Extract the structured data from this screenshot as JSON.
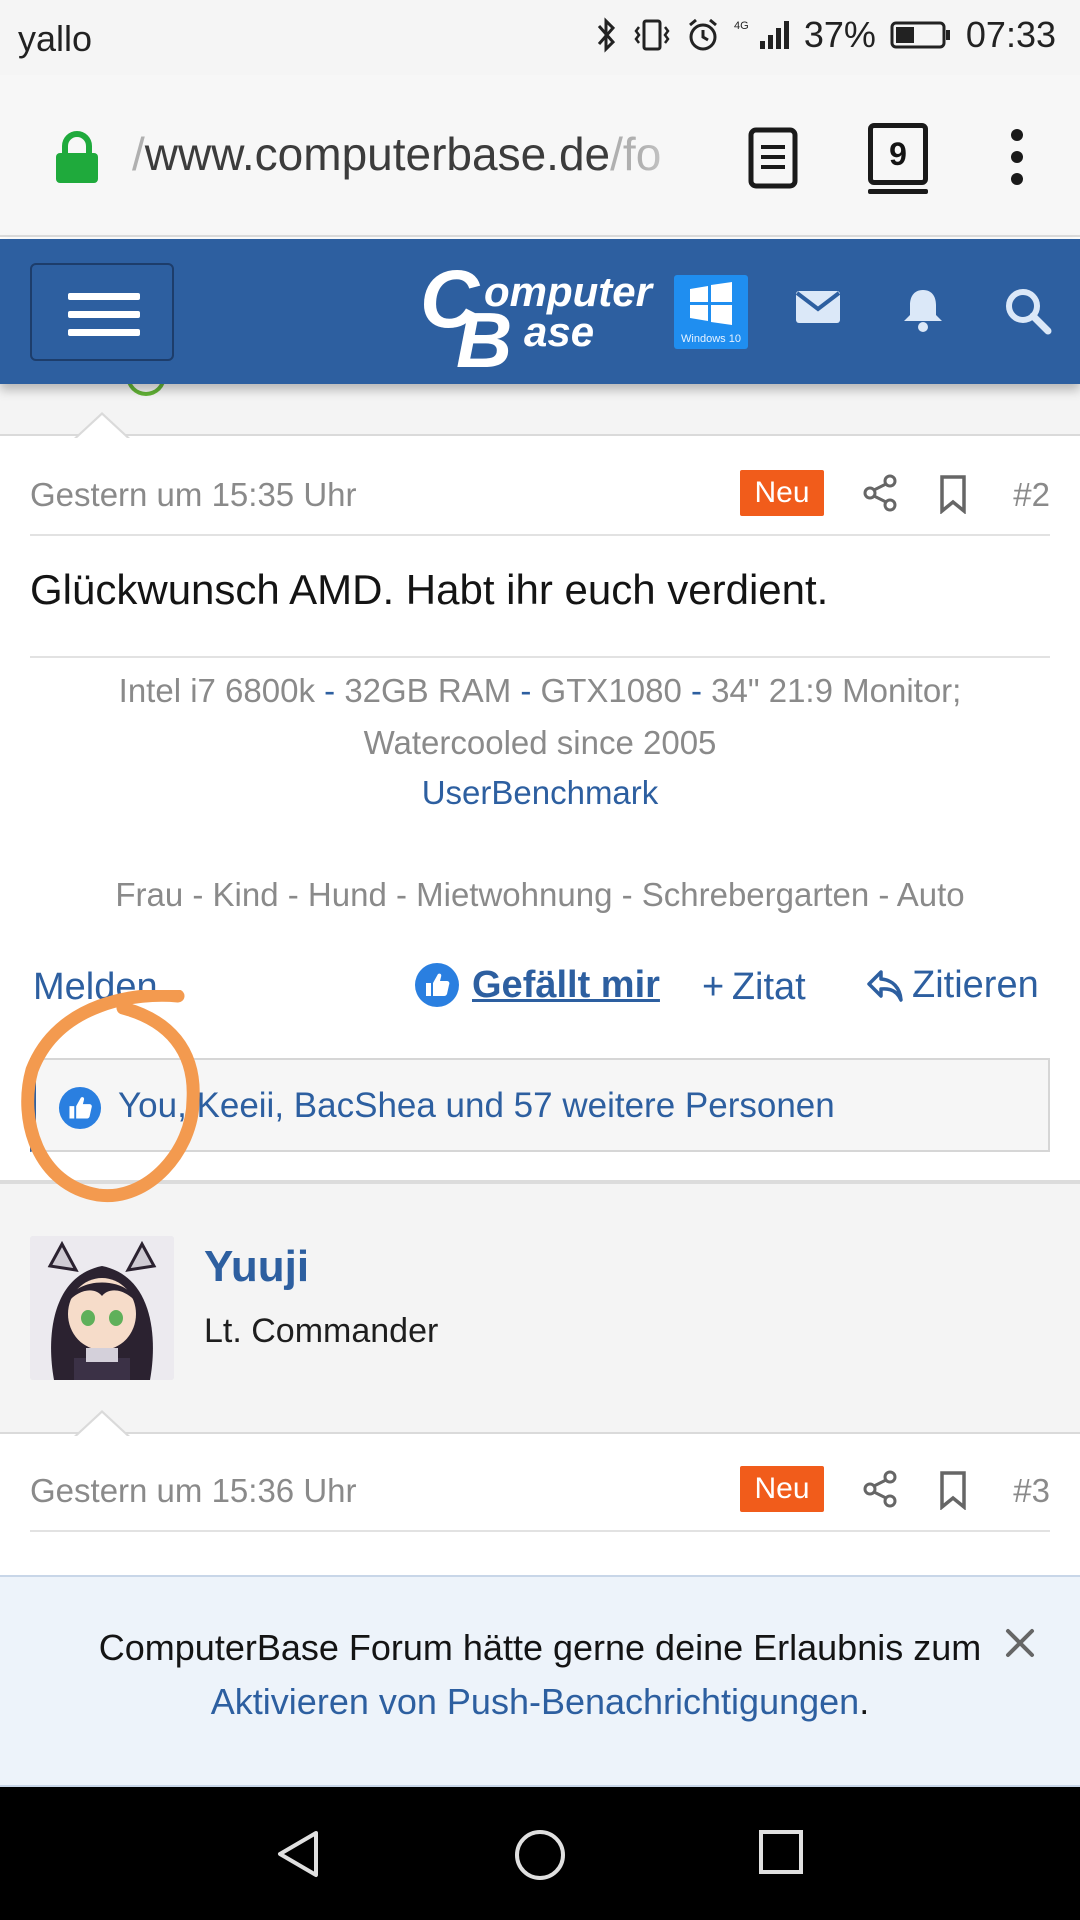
{
  "status_bar": {
    "carrier": "yallo",
    "network": "4G",
    "battery": "37%",
    "time": "07:33"
  },
  "browser": {
    "url_prefix": "/",
    "url_main": "www.computerbase.de",
    "url_suffix": "/fo",
    "tab_count": "9"
  },
  "site": {
    "logo_line1": "omputer",
    "logo_line2": "ase",
    "logo_c": "C",
    "logo_b": "B",
    "windows_badge": "Windows 10",
    "brand_color": "#2d5fa0"
  },
  "post": {
    "date": "Gestern um 15:35 Uhr",
    "badge": "Neu",
    "number": "#2",
    "body": "Glückwunsch AMD. Habt ihr euch verdient.",
    "signature": {
      "items": [
        "Intel i7 6800k",
        "32GB RAM",
        "GTX1080",
        "34\" 21:9 Monitor;"
      ],
      "separator": "-",
      "line2": "Watercooled since 2005",
      "link": "UserBenchmark",
      "line4": "Frau - Kind - Hund - Mietwohnung - Schrebergarten - Auto"
    },
    "actions": {
      "report": "Melden",
      "like": "Gefällt mir",
      "quote_add": "Zitat",
      "quote_reply": "Zitieren"
    },
    "reactions": "You, Keeii, BacShea und 57 weitere Personen"
  },
  "next_post": {
    "username": "Yuuji",
    "user_title": "Lt. Commander",
    "date": "Gestern um 15:36 Uhr",
    "badge": "Neu",
    "number": "#3"
  },
  "push_banner": {
    "text": "ComputerBase Forum hätte gerne deine Erlaubnis zum",
    "link": "Aktivieren von Push-Benachrichtigungen",
    "period": "."
  },
  "icons": {
    "lock": "lock-icon",
    "reader": "reader-mode-icon",
    "menu": "hamburger-icon",
    "mail": "envelope-icon",
    "bell": "bell-icon",
    "search": "search-icon",
    "share": "share-icon",
    "bookmark": "bookmark-icon",
    "like": "thumbs-up-icon",
    "close": "close-icon"
  }
}
